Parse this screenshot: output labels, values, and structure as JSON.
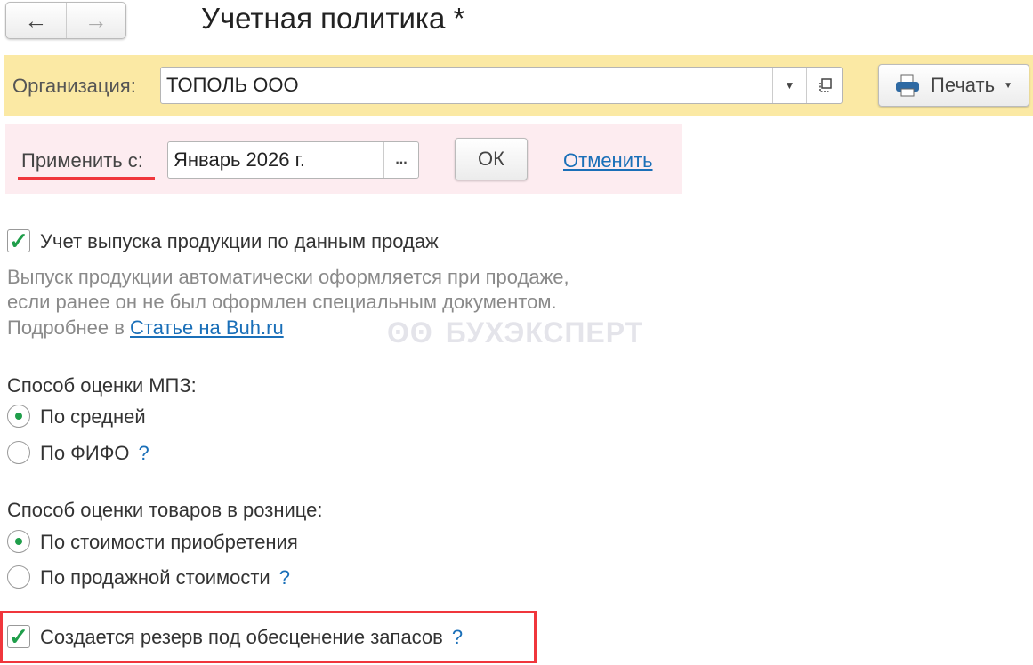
{
  "header": {
    "title": "Учетная политика *",
    "back": "←",
    "forward": "→"
  },
  "org": {
    "label": "Организация:",
    "value": "ТОПОЛЬ ООО",
    "print_label": "Печать"
  },
  "apply": {
    "label": "Применить с:",
    "value": "Январь 2026 г.",
    "select_btn": "...",
    "ok": "ОК",
    "cancel": "Отменить"
  },
  "production": {
    "label": "Учет выпуска продукции по данным продаж",
    "checked": true,
    "desc1": "Выпуск продукции автоматически оформляется при продаже,",
    "desc2": "если ранее он не был оформлен специальным документом.",
    "more_prefix": "Подробнее в ",
    "more_link": "Статье на Buh.ru"
  },
  "watermark": "БУХЭКСПЕРТ",
  "mpz": {
    "label": "Способ оценки МПЗ:",
    "options": [
      {
        "label": "По средней",
        "selected": true
      },
      {
        "label": "По ФИФО",
        "selected": false,
        "help": "?"
      }
    ]
  },
  "retail": {
    "label": "Способ оценки товаров в рознице:",
    "options": [
      {
        "label": "По стоимости приобретения",
        "selected": true
      },
      {
        "label": "По продажной стоимости",
        "selected": false,
        "help": "?"
      }
    ]
  },
  "reserve": {
    "label": "Создается резерв под обесценение запасов",
    "checked": true,
    "help": "?"
  }
}
